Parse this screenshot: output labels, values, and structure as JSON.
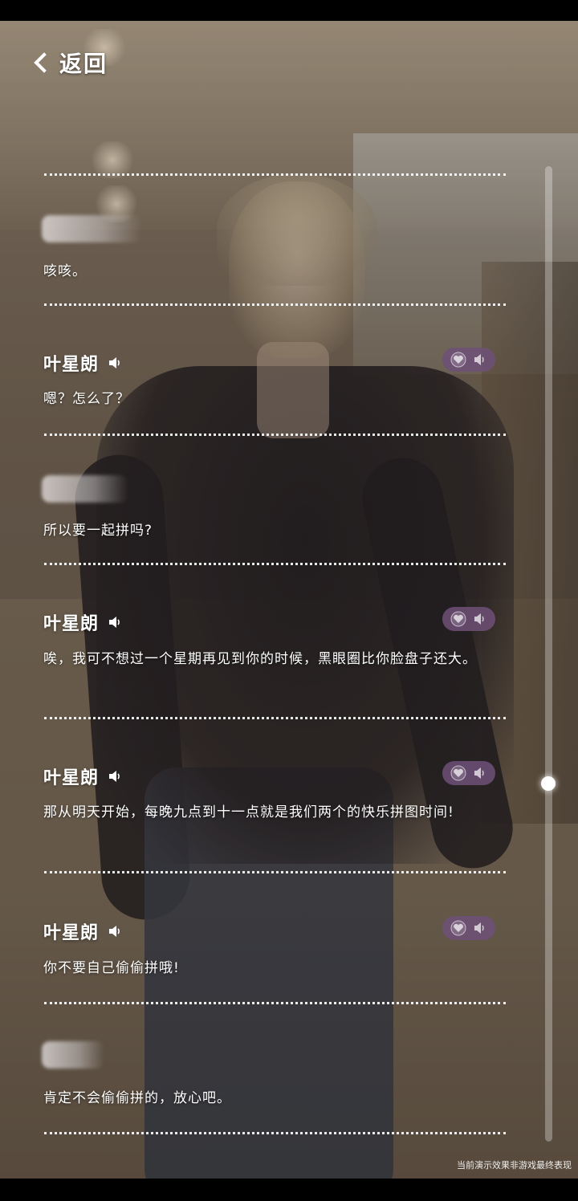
{
  "header": {
    "back_label": "返回"
  },
  "entries": [
    {
      "speaker": "",
      "text": "咳咳。"
    },
    {
      "speaker": "叶星朗",
      "text": "嗯？怎么了？"
    },
    {
      "speaker": "",
      "text": "所以要一起拼吗?"
    },
    {
      "speaker": "叶星朗",
      "text": "唉，我可不想过一个星期再见到你的时候，黑眼圈比你脸盘子还大。"
    },
    {
      "speaker": "叶星朗",
      "text": "那从明天开始，每晚九点到十一点就是我们两个的快乐拼图时间!"
    },
    {
      "speaker": "叶星朗",
      "text": "你不要自己偷偷拼哦!"
    },
    {
      "speaker": "",
      "text": "肯定不会偷偷拼的，放心吧。"
    }
  ],
  "icons": {
    "back": "chevron-left-icon",
    "voice": "speaker-icon",
    "favorite": "heart-icon",
    "replay": "speaker-icon"
  },
  "colors": {
    "pill": "#6e5078",
    "text": "#ffffff"
  },
  "footer": {
    "notice": "当前演示效果非游戏最终表现"
  }
}
